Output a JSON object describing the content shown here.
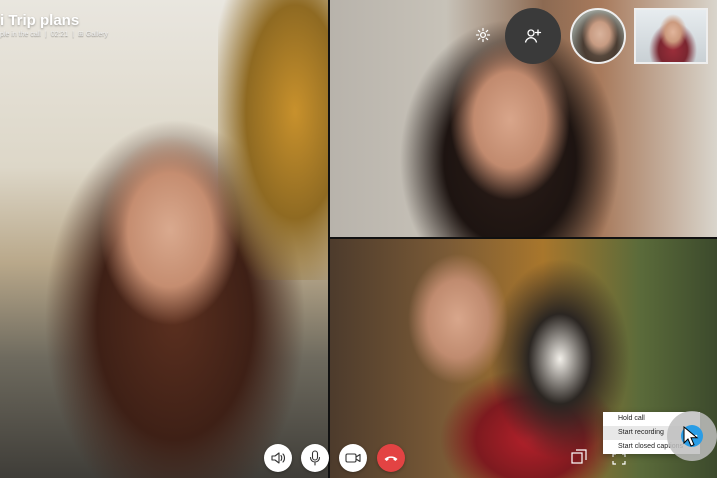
{
  "call": {
    "title": "i Trip plans",
    "meta_participants": "ple in the call",
    "meta_duration": "02:21",
    "meta_view": "Gallery"
  },
  "participants": [
    {
      "name": "",
      "role": "main-left"
    },
    {
      "name": "",
      "role": "top-right"
    },
    {
      "name": "",
      "role": "bottom-right"
    }
  ],
  "thumbnails": [
    {
      "role": "participant-thumbnail"
    },
    {
      "role": "self-view"
    }
  ],
  "controls": {
    "speaker": "speaker-icon",
    "mic": "microphone-icon",
    "video": "video-camera-icon",
    "end": "end-call-icon",
    "end_color": "#e34343"
  },
  "menu": {
    "items": [
      {
        "label": "Hold call",
        "active": false
      },
      {
        "label": "Start recording",
        "active": true
      },
      {
        "label": "Start closed captions",
        "active": false
      }
    ]
  },
  "colors": {
    "accent": "#2a9de6",
    "end_call": "#e34343"
  }
}
